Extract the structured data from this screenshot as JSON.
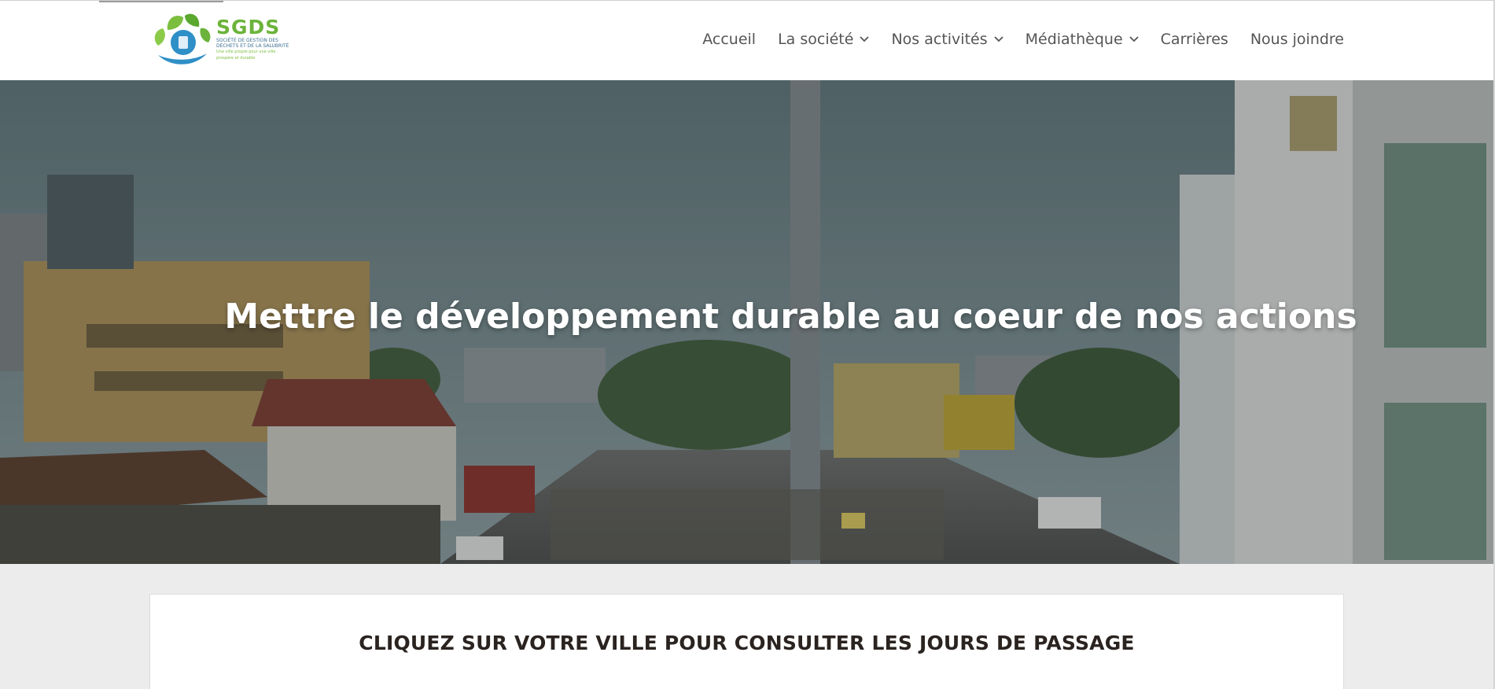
{
  "header": {
    "logo": {
      "title": "SGDS",
      "subtitle_line1": "Société de gestion des",
      "subtitle_line2": "déchets et de la salubrité",
      "tagline": "Une ville propre pour une ville prospère et durable",
      "brand_green": "#6bb33a",
      "brand_blue": "#2f8fc7"
    },
    "nav": [
      {
        "label": "Accueil",
        "has_dropdown": false
      },
      {
        "label": "La société",
        "has_dropdown": true
      },
      {
        "label": "Nos activités",
        "has_dropdown": true
      },
      {
        "label": "Médiathèque",
        "has_dropdown": true
      },
      {
        "label": "Carrières",
        "has_dropdown": false
      },
      {
        "label": "Nous joindre",
        "has_dropdown": false
      }
    ]
  },
  "hero": {
    "title": "Mettre le développement durable au coeur de nos actions"
  },
  "section": {
    "title": "CLIQUEZ SUR VOTRE VILLE POUR CONSULTER LES JOURS DE PASSAGE"
  }
}
